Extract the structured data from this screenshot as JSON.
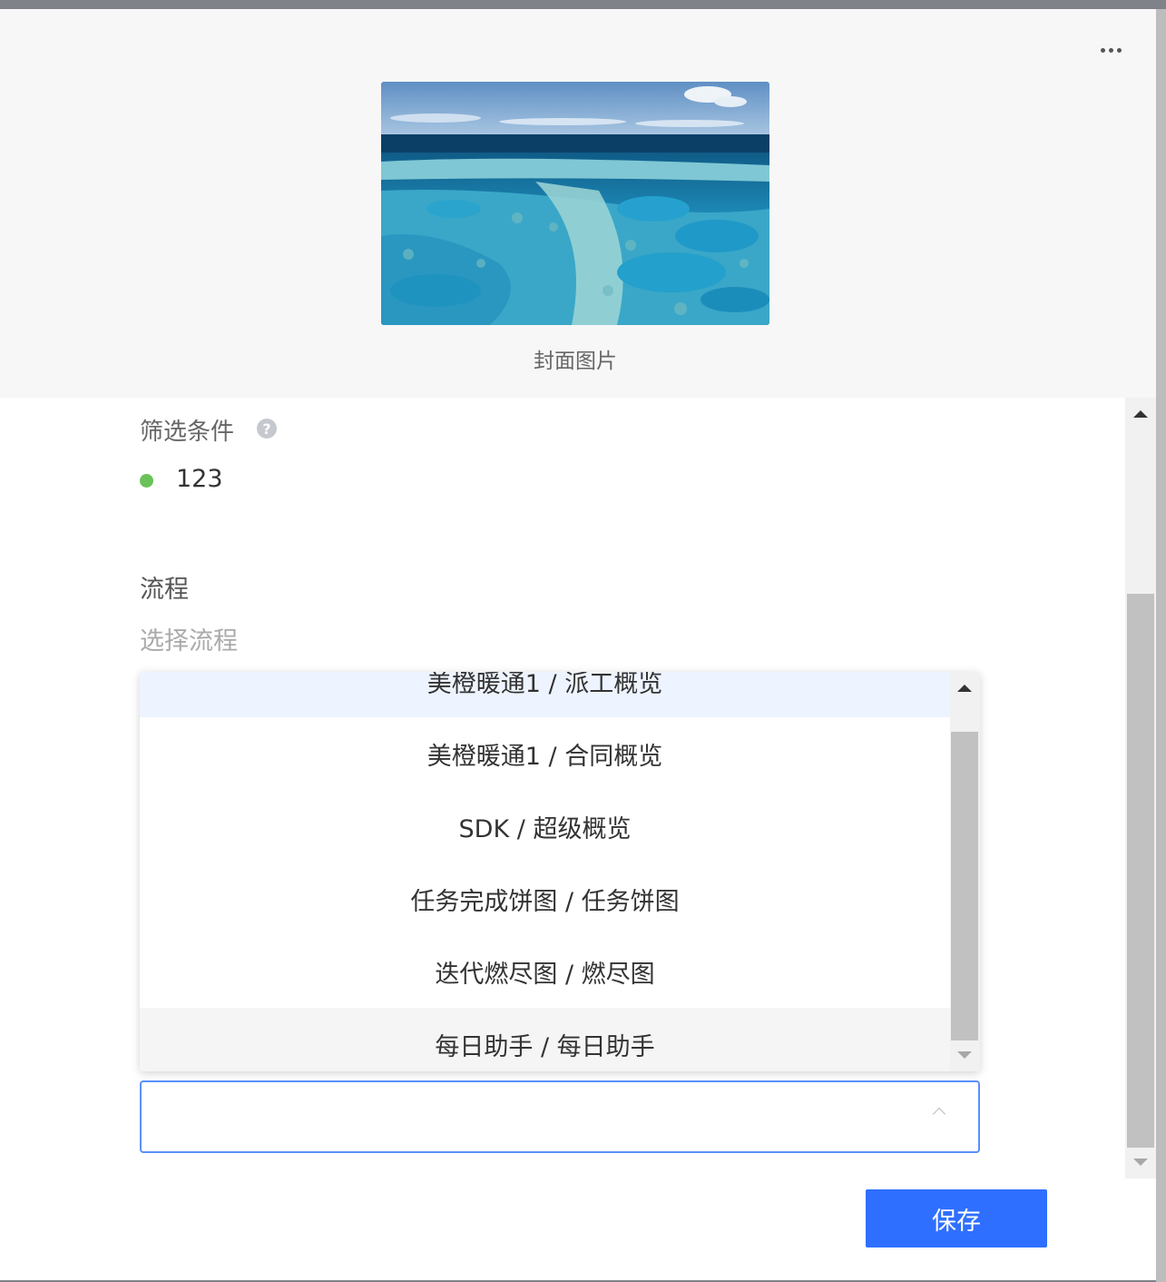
{
  "header": {
    "more_label": "•••",
    "cover_label": "封面图片"
  },
  "filter": {
    "label": "筛选条件",
    "help_glyph": "?",
    "value": "123",
    "status_color": "#6ac259"
  },
  "process": {
    "label": "流程",
    "hint": "选择流程"
  },
  "dropdown": {
    "items": [
      {
        "label": "美橙暖通1 / 派工概览"
      },
      {
        "label": "美橙暖通1 / 合同概览"
      },
      {
        "label": "SDK / 超级概览"
      },
      {
        "label": "任务完成饼图 / 任务饼图"
      },
      {
        "label": "迭代燃尽图 / 燃尽图"
      },
      {
        "label": "每日助手 / 每日助手"
      }
    ]
  },
  "select": {
    "value": ""
  },
  "footer": {
    "save_label": "保存"
  },
  "colors": {
    "accent": "#2f6fff",
    "input_border": "#5b8ff9",
    "selected_bg": "#eef4ff"
  }
}
